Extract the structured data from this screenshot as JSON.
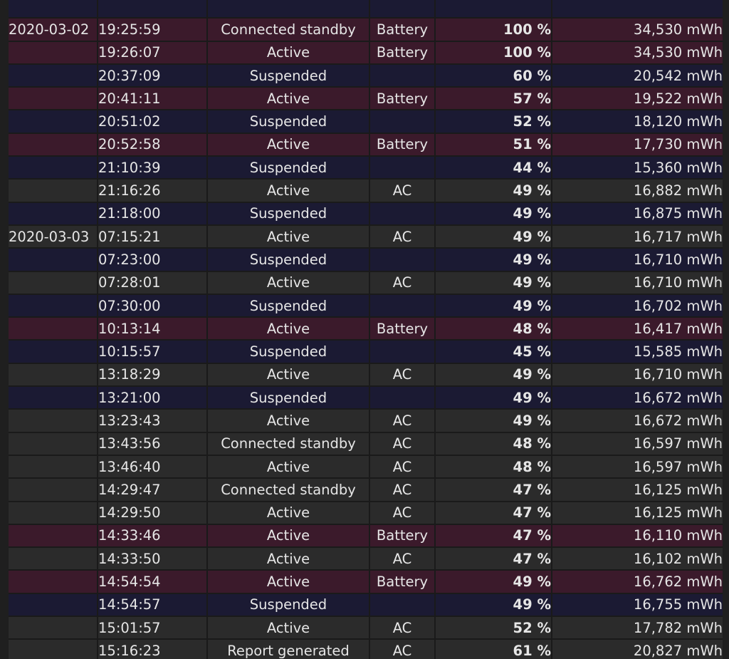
{
  "rows": [
    {
      "date": "",
      "time": "",
      "state": "",
      "source": "",
      "percent": "",
      "capacity": "",
      "kind": "sus"
    },
    {
      "date": "2020-03-02",
      "time": "19:25:59",
      "state": "Connected standby",
      "source": "Battery",
      "percent": "100 %",
      "capacity": "34,530 mWh",
      "kind": "bat"
    },
    {
      "date": "",
      "time": "19:26:07",
      "state": "Active",
      "source": "Battery",
      "percent": "100 %",
      "capacity": "34,530 mWh",
      "kind": "bat"
    },
    {
      "date": "",
      "time": "20:37:09",
      "state": "Suspended",
      "source": "",
      "percent": "60 %",
      "capacity": "20,542 mWh",
      "kind": "sus"
    },
    {
      "date": "",
      "time": "20:41:11",
      "state": "Active",
      "source": "Battery",
      "percent": "57 %",
      "capacity": "19,522 mWh",
      "kind": "bat"
    },
    {
      "date": "",
      "time": "20:51:02",
      "state": "Suspended",
      "source": "",
      "percent": "52 %",
      "capacity": "18,120 mWh",
      "kind": "sus"
    },
    {
      "date": "",
      "time": "20:52:58",
      "state": "Active",
      "source": "Battery",
      "percent": "51 %",
      "capacity": "17,730 mWh",
      "kind": "bat"
    },
    {
      "date": "",
      "time": "21:10:39",
      "state": "Suspended",
      "source": "",
      "percent": "44 %",
      "capacity": "15,360 mWh",
      "kind": "sus"
    },
    {
      "date": "",
      "time": "21:16:26",
      "state": "Active",
      "source": "AC",
      "percent": "49 %",
      "capacity": "16,882 mWh",
      "kind": "ac"
    },
    {
      "date": "",
      "time": "21:18:00",
      "state": "Suspended",
      "source": "",
      "percent": "49 %",
      "capacity": "16,875 mWh",
      "kind": "sus"
    },
    {
      "date": "2020-03-03",
      "time": "07:15:21",
      "state": "Active",
      "source": "AC",
      "percent": "49 %",
      "capacity": "16,717 mWh",
      "kind": "ac"
    },
    {
      "date": "",
      "time": "07:23:00",
      "state": "Suspended",
      "source": "",
      "percent": "49 %",
      "capacity": "16,710 mWh",
      "kind": "sus"
    },
    {
      "date": "",
      "time": "07:28:01",
      "state": "Active",
      "source": "AC",
      "percent": "49 %",
      "capacity": "16,710 mWh",
      "kind": "ac"
    },
    {
      "date": "",
      "time": "07:30:00",
      "state": "Suspended",
      "source": "",
      "percent": "49 %",
      "capacity": "16,702 mWh",
      "kind": "sus"
    },
    {
      "date": "",
      "time": "10:13:14",
      "state": "Active",
      "source": "Battery",
      "percent": "48 %",
      "capacity": "16,417 mWh",
      "kind": "bat"
    },
    {
      "date": "",
      "time": "10:15:57",
      "state": "Suspended",
      "source": "",
      "percent": "45 %",
      "capacity": "15,585 mWh",
      "kind": "sus"
    },
    {
      "date": "",
      "time": "13:18:29",
      "state": "Active",
      "source": "AC",
      "percent": "49 %",
      "capacity": "16,710 mWh",
      "kind": "ac"
    },
    {
      "date": "",
      "time": "13:21:00",
      "state": "Suspended",
      "source": "",
      "percent": "49 %",
      "capacity": "16,672 mWh",
      "kind": "sus"
    },
    {
      "date": "",
      "time": "13:23:43",
      "state": "Active",
      "source": "AC",
      "percent": "49 %",
      "capacity": "16,672 mWh",
      "kind": "ac"
    },
    {
      "date": "",
      "time": "13:43:56",
      "state": "Connected standby",
      "source": "AC",
      "percent": "48 %",
      "capacity": "16,597 mWh",
      "kind": "ac"
    },
    {
      "date": "",
      "time": "13:46:40",
      "state": "Active",
      "source": "AC",
      "percent": "48 %",
      "capacity": "16,597 mWh",
      "kind": "ac"
    },
    {
      "date": "",
      "time": "14:29:47",
      "state": "Connected standby",
      "source": "AC",
      "percent": "47 %",
      "capacity": "16,125 mWh",
      "kind": "ac"
    },
    {
      "date": "",
      "time": "14:29:50",
      "state": "Active",
      "source": "AC",
      "percent": "47 %",
      "capacity": "16,125 mWh",
      "kind": "ac"
    },
    {
      "date": "",
      "time": "14:33:46",
      "state": "Active",
      "source": "Battery",
      "percent": "47 %",
      "capacity": "16,110 mWh",
      "kind": "bat"
    },
    {
      "date": "",
      "time": "14:33:50",
      "state": "Active",
      "source": "AC",
      "percent": "47 %",
      "capacity": "16,102 mWh",
      "kind": "ac"
    },
    {
      "date": "",
      "time": "14:54:54",
      "state": "Active",
      "source": "Battery",
      "percent": "49 %",
      "capacity": "16,762 mWh",
      "kind": "bat"
    },
    {
      "date": "",
      "time": "14:54:57",
      "state": "Suspended",
      "source": "",
      "percent": "49 %",
      "capacity": "16,755 mWh",
      "kind": "sus"
    },
    {
      "date": "",
      "time": "15:01:57",
      "state": "Active",
      "source": "AC",
      "percent": "52 %",
      "capacity": "17,782 mWh",
      "kind": "ac"
    },
    {
      "date": "",
      "time": "15:16:23",
      "state": "Report generated",
      "source": "AC",
      "percent": "61 %",
      "capacity": "20,827 mWh",
      "kind": "ac"
    }
  ],
  "colors": {
    "background": "#1f1f1f",
    "row_ac": "#2b2b2b",
    "row_battery": "#3b1a2b",
    "row_suspended": "#1b1a33",
    "text": "#e6e6e6"
  }
}
